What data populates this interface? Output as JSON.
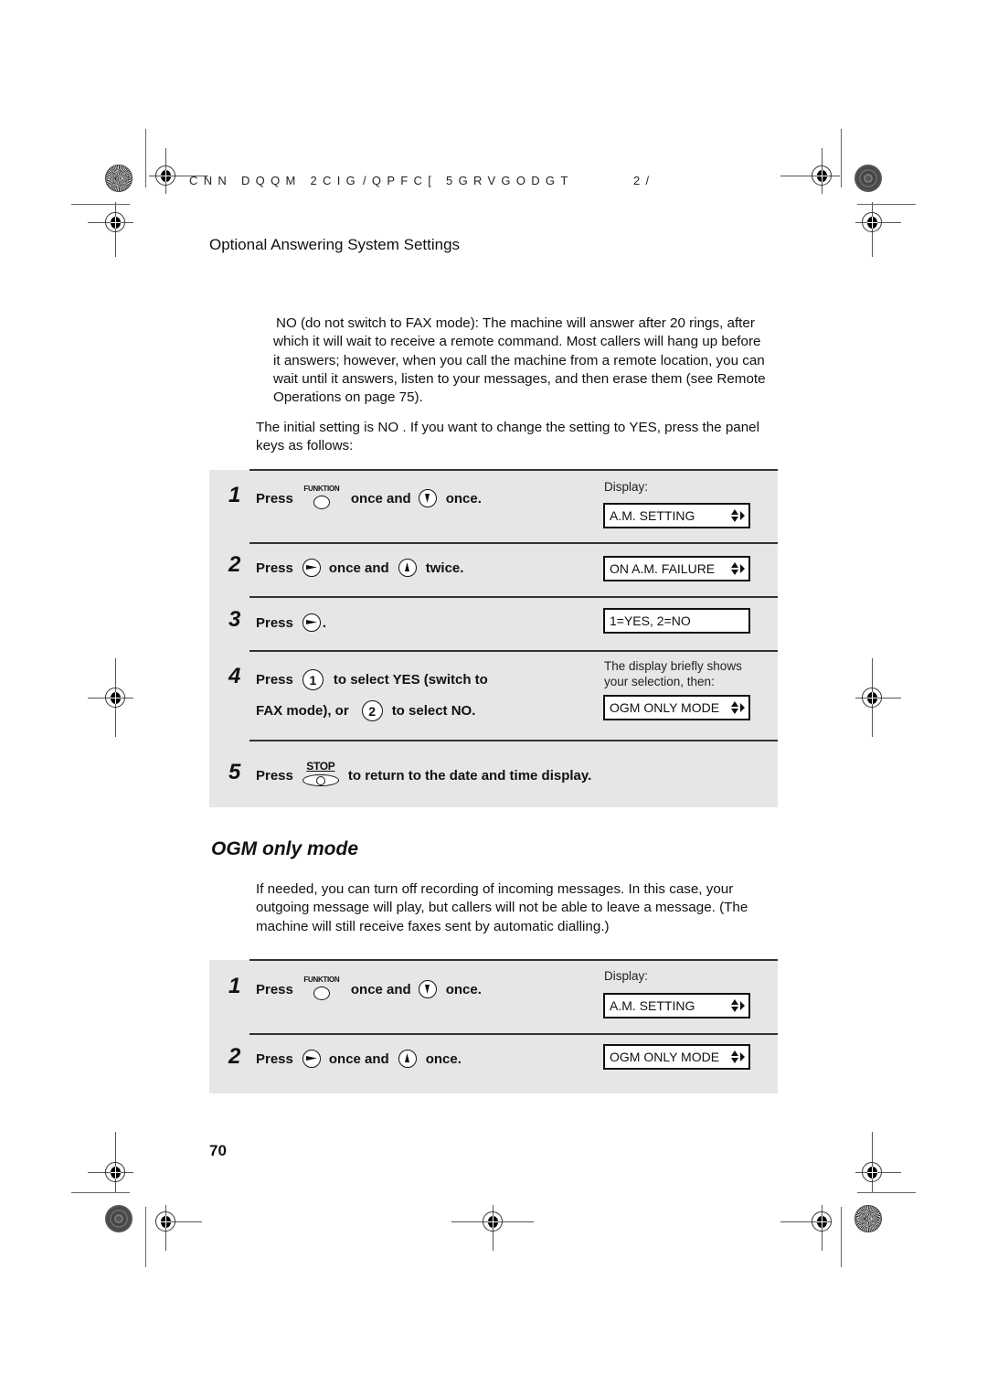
{
  "header": {
    "code_left": "CNN DQQM 2CIG",
    "code_mid": "/QPFC[ 5GRVGODGT",
    "code_right": "2/"
  },
  "section_title": "Optional Answering System Settings",
  "intro": {
    "no_option": "NO (do not switch to FAX mode): The machine will answer after 20 rings, after which it will wait to receive a remote command. Most callers will hang up before it answers; however, when you call the machine from a remote location, you can wait until it answers, listen to your messages, and then erase them (see Remote Operations on page 75).",
    "initial_setting": "The initial setting is NO . If you want to change the setting to YES, press the panel keys as follows:"
  },
  "keys": {
    "funktion": "FUNKTION",
    "stop": "STOP",
    "one": "1",
    "two": "2"
  },
  "panel1": {
    "display_label": "Display:",
    "steps": [
      {
        "num": "1",
        "press": "Press",
        "mid": "once and",
        "end": "once."
      },
      {
        "num": "2",
        "press": "Press",
        "mid": "once and",
        "end": "twice."
      },
      {
        "num": "3",
        "press": "Press",
        "end": "."
      },
      {
        "num": "4",
        "press": "Press",
        "line1_end": "to select YES (switch to",
        "line2_start": "FAX mode), or",
        "line2_end": "to select NO."
      },
      {
        "num": "5",
        "press": "Press",
        "end": "to return to the date and time display."
      }
    ],
    "displays": [
      "A.M. SETTING",
      "ON A.M. FAILURE",
      "1=YES, 2=NO",
      "OGM ONLY MODE"
    ],
    "display_note": "The display briefly shows your selection, then:"
  },
  "ogm": {
    "title": "OGM only mode",
    "description": "If needed, you can turn off recording of incoming messages. In this case, your outgoing message will play, but callers will not be able to leave a message. (The machine will still receive faxes sent by automatic dialling.)"
  },
  "panel2": {
    "display_label": "Display:",
    "steps": [
      {
        "num": "1",
        "press": "Press",
        "mid": "once and",
        "end": "once."
      },
      {
        "num": "2",
        "press": "Press",
        "mid": "once and",
        "end": "once."
      }
    ],
    "displays": [
      "A.M. SETTING",
      "OGM ONLY MODE"
    ]
  },
  "page_number": "70"
}
